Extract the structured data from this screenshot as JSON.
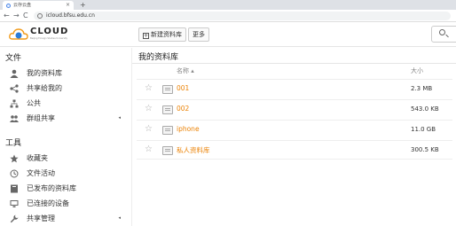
{
  "browser": {
    "tab_title": "云存云盘",
    "tab_close": "×",
    "new_tab": "+",
    "url": "icloud.bfsu.edu.cn",
    "nav_back": "←",
    "nav_forward": "→",
    "nav_reload": "C"
  },
  "header": {
    "logo_text": "CLOUD",
    "logo_sub": "Beijing Foreign Studies University",
    "new_library_label": "新建资料库",
    "more_label": "更多"
  },
  "sidebar": {
    "files_title": "文件",
    "files_items": [
      {
        "label": "我的资料库",
        "icon": "user-icon"
      },
      {
        "label": "共享给我的",
        "icon": "share-icon"
      },
      {
        "label": "公共",
        "icon": "org-icon"
      },
      {
        "label": "群组共享",
        "icon": "group-icon",
        "expand": "◂"
      }
    ],
    "tools_title": "工具",
    "tools_items": [
      {
        "label": "收藏夹",
        "icon": "star-icon"
      },
      {
        "label": "文件活动",
        "icon": "clock-icon"
      },
      {
        "label": "已发布的资料库",
        "icon": "book-icon"
      },
      {
        "label": "已连接的设备",
        "icon": "monitor-icon"
      },
      {
        "label": "共享管理",
        "icon": "wrench-icon",
        "expand": "◂"
      }
    ]
  },
  "main": {
    "title": "我的资料库",
    "col_name": "名称 ▴",
    "col_size": "大小",
    "rows": [
      {
        "name": "001",
        "size": "2.3 MB"
      },
      {
        "name": "002",
        "size": "543.0 KB"
      },
      {
        "name": "iphone",
        "size": "11.0 GB"
      },
      {
        "name": "私人资料库",
        "size": "300.5 KB"
      }
    ]
  },
  "colors": {
    "accent": "#eb8205",
    "logo_blue": "#2b7bd6"
  }
}
